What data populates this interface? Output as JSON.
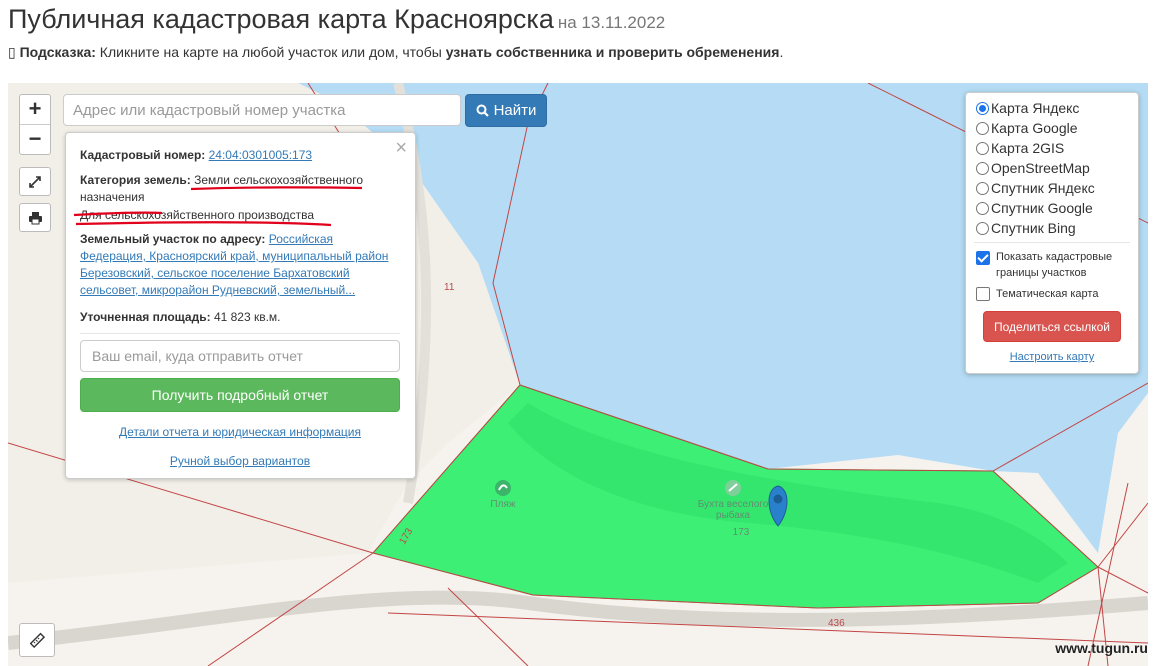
{
  "header": {
    "title": "Публичная кадастровая карта Красноярска",
    "date": "на 13.11.2022"
  },
  "hint": {
    "icon_glyph": "▯",
    "label": "Подсказка:",
    "text_before": " Кликните на карте на любой участок или дом, чтобы ",
    "text_bold": "узнать собственника и проверить обременения",
    "text_after": "."
  },
  "map_controls": {
    "zoom_in": "+",
    "zoom_out": "−"
  },
  "search": {
    "placeholder": "Адрес или кадастровый номер участка",
    "button_label": "Найти"
  },
  "popup": {
    "cadastral_label": "Кадастровый номер:",
    "cadastral_value": "24:04:0301005:173",
    "category_label": "Категория земель:",
    "category_value": "Земли сельскохозяйственного назначения",
    "usage_value": "Для сельскохозяйственного производства",
    "address_label": "Земельный участок по адресу:",
    "address_value": "Российская Федерация, Красноярский край, муниципальный район Березовский, сельское поселение Бархатовский сельсовет, микрорайон Рудневский, земельный...",
    "area_label": "Уточненная площадь:",
    "area_value": "41 823 кв.м.",
    "email_placeholder": "Ваш email, куда отправить отчет",
    "report_button": "Получить подробный отчет",
    "details_link": "Детали отчета и юридическая информация",
    "manual_link": "Ручной выбор вариантов",
    "close": "×"
  },
  "layers": {
    "options": [
      {
        "label": "Карта Яндекс",
        "selected": true
      },
      {
        "label": "Карта Google",
        "selected": false
      },
      {
        "label": "Карта 2GIS",
        "selected": false
      },
      {
        "label": "OpenStreetMap",
        "selected": false
      },
      {
        "label": "Спутник Яндекс",
        "selected": false
      },
      {
        "label": "Спутник Google",
        "selected": false
      },
      {
        "label": "Спутник Bing",
        "selected": false
      }
    ],
    "show_borders_label": "Показать кадастровые границы участков",
    "show_borders_checked": true,
    "thematic_label": "Тематическая карта",
    "thematic_checked": false,
    "share_button": "Поделиться ссылкой",
    "configure_link": "Настроить карту"
  },
  "map_labels": {
    "beach": "Пляж",
    "bay": "Бухта веселого рыбака",
    "parcel_number_center": "173",
    "parcel_number_left": "173",
    "road_11": "11",
    "road_436": "436"
  },
  "watermark": "www.tugun.ru",
  "colors": {
    "water": "#b5dcf4",
    "parcel_fill": "#2cf06a",
    "border_lines": "#c24545",
    "search_button": "#337ab7",
    "report_button": "#5cb85c",
    "share_button": "#d9534f"
  }
}
